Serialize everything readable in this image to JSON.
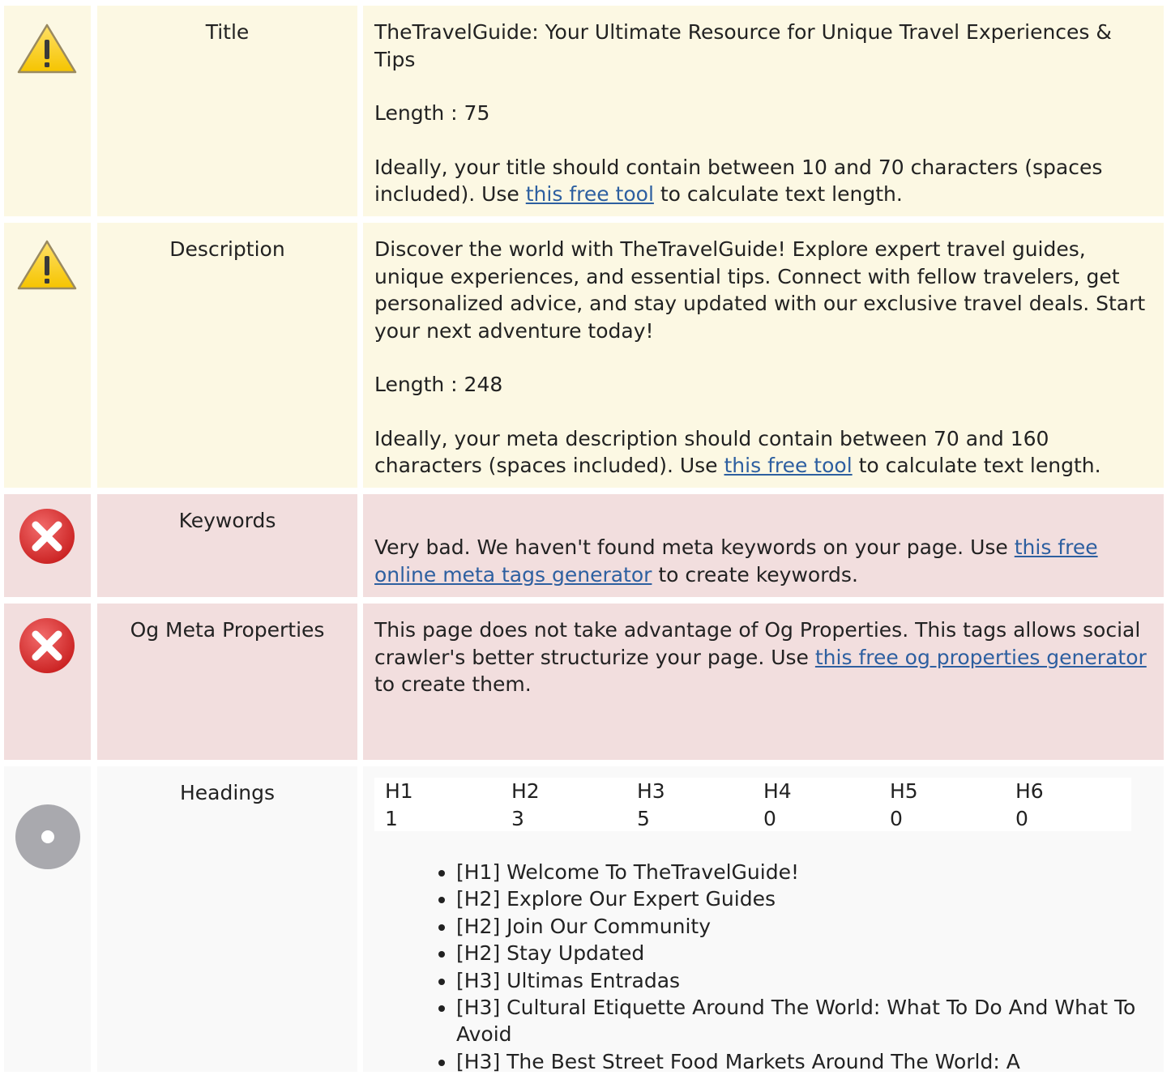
{
  "rows": {
    "title": {
      "label": "Title",
      "status_icon": "warning-icon",
      "value": "TheTravelGuide: Your Ultimate Resource for Unique Travel Experiences & Tips",
      "length_text": "Length : 75",
      "advice_before": "Ideally, your title should contain between 10 and 70 characters (spaces included). Use ",
      "link_text": "this free tool",
      "advice_after": " to calculate text length."
    },
    "description": {
      "label": "Description",
      "status_icon": "warning-icon",
      "value": "Discover the world with TheTravelGuide! Explore expert travel guides, unique experiences, and essential tips. Connect with fellow travelers, get personalized advice, and stay updated with our exclusive travel deals. Start your next adventure today!",
      "length_text": "Length : 248",
      "advice_before": "Ideally, your meta description should contain between 70 and 160 characters (spaces included). Use ",
      "link_text": "this free tool",
      "advice_after": " to calculate text length."
    },
    "keywords": {
      "label": "Keywords",
      "status_icon": "error-icon",
      "text_before": "Very bad. We haven't found meta keywords on your page. Use ",
      "link_text": "this free online meta tags generator",
      "text_after": " to create keywords."
    },
    "og": {
      "label": "Og Meta Properties",
      "status_icon": "error-icon",
      "text_before": "This page does not take advantage of Og Properties. This tags allows social crawler's better structurize your page. Use ",
      "link_text": "this free og properties generator",
      "text_after": " to create them."
    },
    "headings": {
      "label": "Headings",
      "status_icon": "info-icon",
      "columns": [
        {
          "tag": "H1",
          "count": "1"
        },
        {
          "tag": "H2",
          "count": "3"
        },
        {
          "tag": "H3",
          "count": "5"
        },
        {
          "tag": "H4",
          "count": "0"
        },
        {
          "tag": "H5",
          "count": "0"
        },
        {
          "tag": "H6",
          "count": "0"
        }
      ],
      "items": [
        "[H1] Welcome To TheTravelGuide!",
        "[H2] Explore Our Expert Guides",
        "[H2] Join Our Community",
        "[H2] Stay Updated",
        "[H3] Ultimas Entradas",
        "[H3] Cultural Etiquette Around The World: What To Do And What To Avoid",
        "[H3] The Best Street Food Markets Around The World: A"
      ]
    }
  },
  "colors": {
    "warning_bg": "#fcf8e3",
    "error_bg": "#f2dede",
    "info_bg": "#f9f9f9",
    "link": "#2d5fa0"
  }
}
